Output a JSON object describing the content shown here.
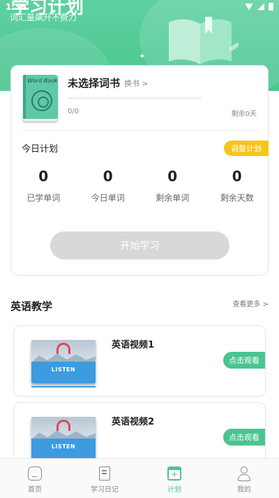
{
  "status_bar": {
    "time": "1:39"
  },
  "hero": {
    "title": "学习计划",
    "subtitle": "词汇量飙升不费力"
  },
  "plan_card": {
    "book_cover_title": "Word Book",
    "book_name": "未选择词书",
    "change_book": "换书 >",
    "progress_text": "0/0",
    "progress_fraction": 0,
    "remaining_days": "剩余0天",
    "today_plan_label": "今日计划",
    "adjust_plan_button": "调整计划",
    "stats": [
      {
        "value": "0",
        "label": "已学单词"
      },
      {
        "value": "0",
        "label": "今日单词"
      },
      {
        "value": "0",
        "label": "剩余单词"
      },
      {
        "value": "0",
        "label": "剩余天数"
      }
    ],
    "start_button": "开始学习"
  },
  "english_teaching": {
    "title": "英语教学",
    "see_more": "查看更多 >",
    "videos": [
      {
        "title": "英语视频1",
        "thumb_text": "LISTEN",
        "button": "点击观看"
      },
      {
        "title": "英语视频2",
        "thumb_text": "LISTEN",
        "button": "点击观看"
      }
    ]
  },
  "tabbar": {
    "items": [
      {
        "label": "首页",
        "icon": "home-icon"
      },
      {
        "label": "学习日记",
        "icon": "diary-icon"
      },
      {
        "label": "计划",
        "icon": "plan-calendar-icon",
        "active": true
      },
      {
        "label": "我的",
        "icon": "profile-icon"
      }
    ]
  },
  "colors": {
    "accent": "#49c58f",
    "adjust": "#f5c518",
    "disabled": "#d8d8d8"
  }
}
